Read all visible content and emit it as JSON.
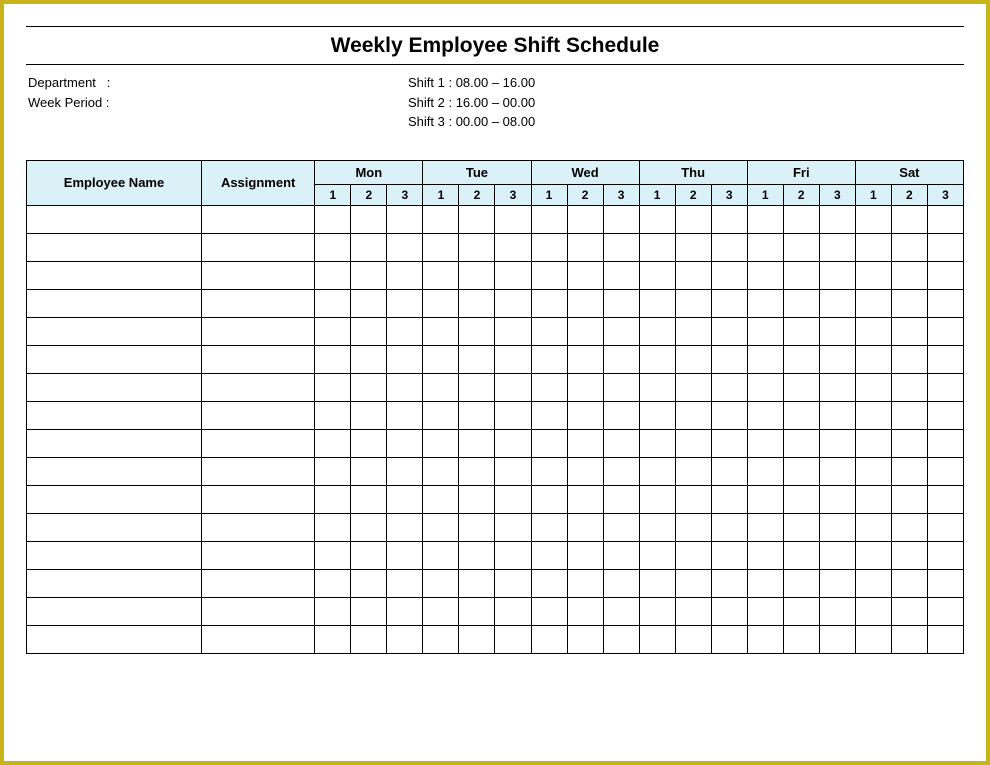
{
  "title": "Weekly Employee Shift Schedule",
  "meta": {
    "department_label": "Department   :",
    "week_period_label": "Week Period :",
    "shift1": "Shift 1 : 08.00 – 16.00",
    "shift2": "Shift 2 : 16.00 – 00.00",
    "shift3": "Shift 3 : 00.00 – 08.00"
  },
  "headers": {
    "employee_name": "Employee Name",
    "assignment": "Assignment",
    "days": [
      "Mon",
      "Tue",
      "Wed",
      "Thu",
      "Fri",
      "Sat"
    ],
    "shifts": [
      "1",
      "2",
      "3"
    ]
  },
  "rows": 16
}
